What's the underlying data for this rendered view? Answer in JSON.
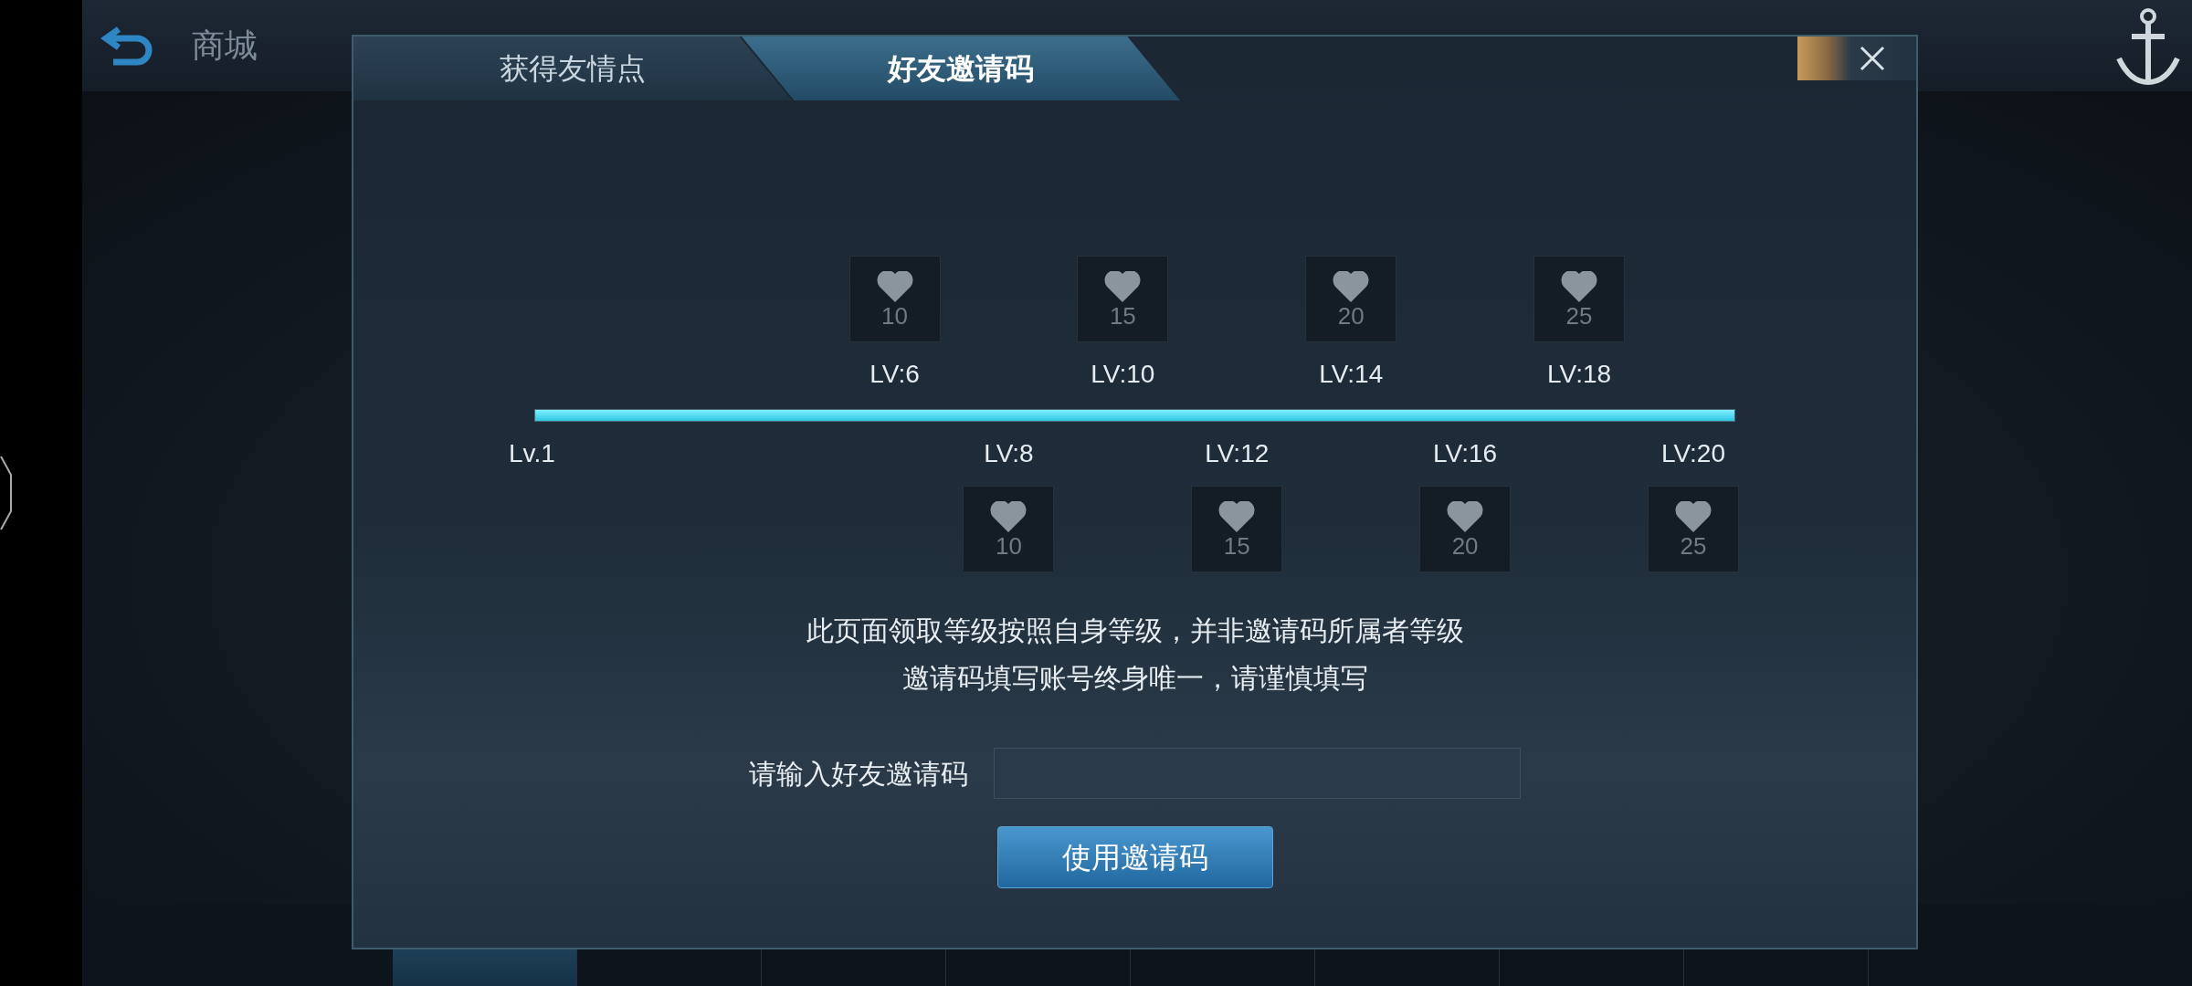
{
  "top_bar": {
    "title": "商城"
  },
  "bottom_tabs": [
    {
      "selected": true
    },
    {
      "selected": false
    },
    {
      "selected": false
    },
    {
      "selected": false
    },
    {
      "selected": false
    },
    {
      "selected": false
    },
    {
      "selected": false
    },
    {
      "selected": false
    }
  ],
  "tabs": [
    {
      "label": "获得友情点",
      "selected": false
    },
    {
      "label": "好友邀请码",
      "selected": true
    }
  ],
  "progress": {
    "start_label": "Lv.1",
    "level": 1,
    "milestones": [
      {
        "label": "LV:6",
        "reward": "10",
        "kind": "above"
      },
      {
        "label": "LV:8",
        "reward": "10",
        "kind": "below"
      },
      {
        "label": "LV:10",
        "reward": "15",
        "kind": "above"
      },
      {
        "label": "LV:12",
        "reward": "15",
        "kind": "below"
      },
      {
        "label": "LV:14",
        "reward": "20",
        "kind": "above"
      },
      {
        "label": "LV:16",
        "reward": "20",
        "kind": "below"
      },
      {
        "label": "LV:18",
        "reward": "25",
        "kind": "above"
      },
      {
        "label": "LV:20",
        "reward": "25",
        "kind": "below"
      }
    ]
  },
  "notes": [
    "此页面领取等级按照自身等级，并非邀请码所属者等级",
    "邀请码填写账号终身唯一，请谨慎填写"
  ],
  "invite": {
    "label": "请输入好友邀请码",
    "button": "使用邀请码"
  }
}
